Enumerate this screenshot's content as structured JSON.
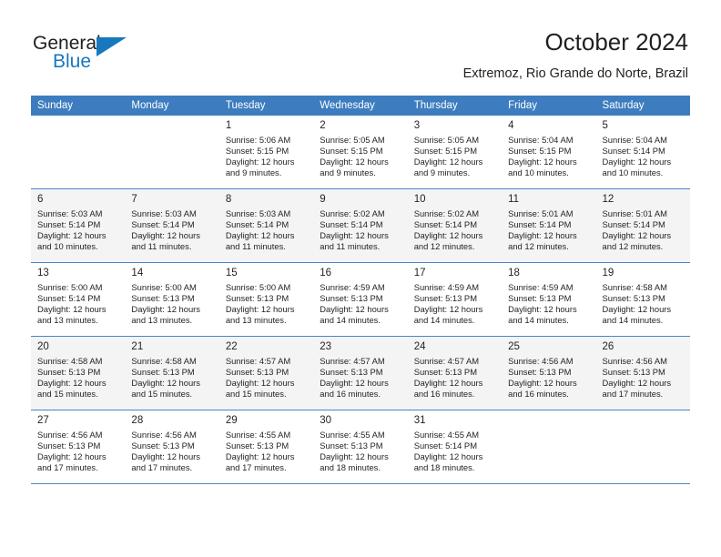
{
  "brand": {
    "name_top": "General",
    "name_bottom": "Blue"
  },
  "header": {
    "title": "October 2024",
    "subtitle": "Extremoz, Rio Grande do Norte, Brazil",
    "accent_color": "#3d7dbf",
    "brand_blue": "#1878be"
  },
  "weekday_headers": [
    "Sunday",
    "Monday",
    "Tuesday",
    "Wednesday",
    "Thursday",
    "Friday",
    "Saturday"
  ],
  "labels": {
    "sunrise": "Sunrise:",
    "sunset": "Sunset:",
    "daylight": "Daylight:"
  },
  "weeks": [
    {
      "shaded": false,
      "days": [
        {
          "num": "",
          "sunrise": "",
          "sunset": "",
          "daylight_1": "",
          "daylight_2": "",
          "empty": true
        },
        {
          "num": "",
          "sunrise": "",
          "sunset": "",
          "daylight_1": "",
          "daylight_2": "",
          "empty": true
        },
        {
          "num": "1",
          "sunrise": "Sunrise: 5:06 AM",
          "sunset": "Sunset: 5:15 PM",
          "daylight_1": "Daylight: 12 hours",
          "daylight_2": "and 9 minutes.",
          "empty": false
        },
        {
          "num": "2",
          "sunrise": "Sunrise: 5:05 AM",
          "sunset": "Sunset: 5:15 PM",
          "daylight_1": "Daylight: 12 hours",
          "daylight_2": "and 9 minutes.",
          "empty": false
        },
        {
          "num": "3",
          "sunrise": "Sunrise: 5:05 AM",
          "sunset": "Sunset: 5:15 PM",
          "daylight_1": "Daylight: 12 hours",
          "daylight_2": "and 9 minutes.",
          "empty": false
        },
        {
          "num": "4",
          "sunrise": "Sunrise: 5:04 AM",
          "sunset": "Sunset: 5:15 PM",
          "daylight_1": "Daylight: 12 hours",
          "daylight_2": "and 10 minutes.",
          "empty": false
        },
        {
          "num": "5",
          "sunrise": "Sunrise: 5:04 AM",
          "sunset": "Sunset: 5:14 PM",
          "daylight_1": "Daylight: 12 hours",
          "daylight_2": "and 10 minutes.",
          "empty": false
        }
      ]
    },
    {
      "shaded": true,
      "days": [
        {
          "num": "6",
          "sunrise": "Sunrise: 5:03 AM",
          "sunset": "Sunset: 5:14 PM",
          "daylight_1": "Daylight: 12 hours",
          "daylight_2": "and 10 minutes.",
          "empty": false
        },
        {
          "num": "7",
          "sunrise": "Sunrise: 5:03 AM",
          "sunset": "Sunset: 5:14 PM",
          "daylight_1": "Daylight: 12 hours",
          "daylight_2": "and 11 minutes.",
          "empty": false
        },
        {
          "num": "8",
          "sunrise": "Sunrise: 5:03 AM",
          "sunset": "Sunset: 5:14 PM",
          "daylight_1": "Daylight: 12 hours",
          "daylight_2": "and 11 minutes.",
          "empty": false
        },
        {
          "num": "9",
          "sunrise": "Sunrise: 5:02 AM",
          "sunset": "Sunset: 5:14 PM",
          "daylight_1": "Daylight: 12 hours",
          "daylight_2": "and 11 minutes.",
          "empty": false
        },
        {
          "num": "10",
          "sunrise": "Sunrise: 5:02 AM",
          "sunset": "Sunset: 5:14 PM",
          "daylight_1": "Daylight: 12 hours",
          "daylight_2": "and 12 minutes.",
          "empty": false
        },
        {
          "num": "11",
          "sunrise": "Sunrise: 5:01 AM",
          "sunset": "Sunset: 5:14 PM",
          "daylight_1": "Daylight: 12 hours",
          "daylight_2": "and 12 minutes.",
          "empty": false
        },
        {
          "num": "12",
          "sunrise": "Sunrise: 5:01 AM",
          "sunset": "Sunset: 5:14 PM",
          "daylight_1": "Daylight: 12 hours",
          "daylight_2": "and 12 minutes.",
          "empty": false
        }
      ]
    },
    {
      "shaded": false,
      "days": [
        {
          "num": "13",
          "sunrise": "Sunrise: 5:00 AM",
          "sunset": "Sunset: 5:14 PM",
          "daylight_1": "Daylight: 12 hours",
          "daylight_2": "and 13 minutes.",
          "empty": false
        },
        {
          "num": "14",
          "sunrise": "Sunrise: 5:00 AM",
          "sunset": "Sunset: 5:13 PM",
          "daylight_1": "Daylight: 12 hours",
          "daylight_2": "and 13 minutes.",
          "empty": false
        },
        {
          "num": "15",
          "sunrise": "Sunrise: 5:00 AM",
          "sunset": "Sunset: 5:13 PM",
          "daylight_1": "Daylight: 12 hours",
          "daylight_2": "and 13 minutes.",
          "empty": false
        },
        {
          "num": "16",
          "sunrise": "Sunrise: 4:59 AM",
          "sunset": "Sunset: 5:13 PM",
          "daylight_1": "Daylight: 12 hours",
          "daylight_2": "and 14 minutes.",
          "empty": false
        },
        {
          "num": "17",
          "sunrise": "Sunrise: 4:59 AM",
          "sunset": "Sunset: 5:13 PM",
          "daylight_1": "Daylight: 12 hours",
          "daylight_2": "and 14 minutes.",
          "empty": false
        },
        {
          "num": "18",
          "sunrise": "Sunrise: 4:59 AM",
          "sunset": "Sunset: 5:13 PM",
          "daylight_1": "Daylight: 12 hours",
          "daylight_2": "and 14 minutes.",
          "empty": false
        },
        {
          "num": "19",
          "sunrise": "Sunrise: 4:58 AM",
          "sunset": "Sunset: 5:13 PM",
          "daylight_1": "Daylight: 12 hours",
          "daylight_2": "and 14 minutes.",
          "empty": false
        }
      ]
    },
    {
      "shaded": true,
      "days": [
        {
          "num": "20",
          "sunrise": "Sunrise: 4:58 AM",
          "sunset": "Sunset: 5:13 PM",
          "daylight_1": "Daylight: 12 hours",
          "daylight_2": "and 15 minutes.",
          "empty": false
        },
        {
          "num": "21",
          "sunrise": "Sunrise: 4:58 AM",
          "sunset": "Sunset: 5:13 PM",
          "daylight_1": "Daylight: 12 hours",
          "daylight_2": "and 15 minutes.",
          "empty": false
        },
        {
          "num": "22",
          "sunrise": "Sunrise: 4:57 AM",
          "sunset": "Sunset: 5:13 PM",
          "daylight_1": "Daylight: 12 hours",
          "daylight_2": "and 15 minutes.",
          "empty": false
        },
        {
          "num": "23",
          "sunrise": "Sunrise: 4:57 AM",
          "sunset": "Sunset: 5:13 PM",
          "daylight_1": "Daylight: 12 hours",
          "daylight_2": "and 16 minutes.",
          "empty": false
        },
        {
          "num": "24",
          "sunrise": "Sunrise: 4:57 AM",
          "sunset": "Sunset: 5:13 PM",
          "daylight_1": "Daylight: 12 hours",
          "daylight_2": "and 16 minutes.",
          "empty": false
        },
        {
          "num": "25",
          "sunrise": "Sunrise: 4:56 AM",
          "sunset": "Sunset: 5:13 PM",
          "daylight_1": "Daylight: 12 hours",
          "daylight_2": "and 16 minutes.",
          "empty": false
        },
        {
          "num": "26",
          "sunrise": "Sunrise: 4:56 AM",
          "sunset": "Sunset: 5:13 PM",
          "daylight_1": "Daylight: 12 hours",
          "daylight_2": "and 17 minutes.",
          "empty": false
        }
      ]
    },
    {
      "shaded": false,
      "days": [
        {
          "num": "27",
          "sunrise": "Sunrise: 4:56 AM",
          "sunset": "Sunset: 5:13 PM",
          "daylight_1": "Daylight: 12 hours",
          "daylight_2": "and 17 minutes.",
          "empty": false
        },
        {
          "num": "28",
          "sunrise": "Sunrise: 4:56 AM",
          "sunset": "Sunset: 5:13 PM",
          "daylight_1": "Daylight: 12 hours",
          "daylight_2": "and 17 minutes.",
          "empty": false
        },
        {
          "num": "29",
          "sunrise": "Sunrise: 4:55 AM",
          "sunset": "Sunset: 5:13 PM",
          "daylight_1": "Daylight: 12 hours",
          "daylight_2": "and 17 minutes.",
          "empty": false
        },
        {
          "num": "30",
          "sunrise": "Sunrise: 4:55 AM",
          "sunset": "Sunset: 5:13 PM",
          "daylight_1": "Daylight: 12 hours",
          "daylight_2": "and 18 minutes.",
          "empty": false
        },
        {
          "num": "31",
          "sunrise": "Sunrise: 4:55 AM",
          "sunset": "Sunset: 5:14 PM",
          "daylight_1": "Daylight: 12 hours",
          "daylight_2": "and 18 minutes.",
          "empty": false
        },
        {
          "num": "",
          "sunrise": "",
          "sunset": "",
          "daylight_1": "",
          "daylight_2": "",
          "empty": true
        },
        {
          "num": "",
          "sunrise": "",
          "sunset": "",
          "daylight_1": "",
          "daylight_2": "",
          "empty": true
        }
      ]
    }
  ]
}
